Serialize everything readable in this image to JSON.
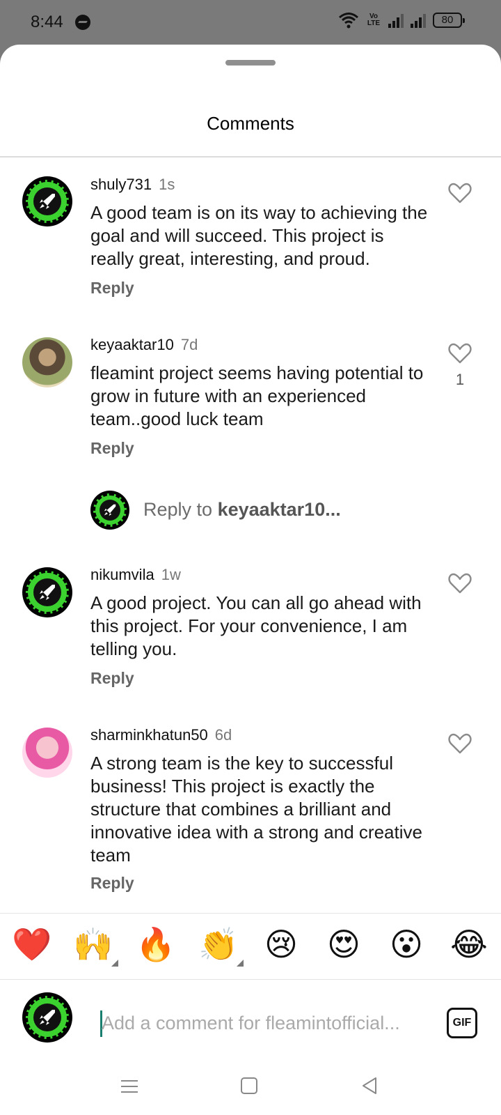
{
  "status_bar": {
    "time": "8:44",
    "volte_label": "Vo LTE",
    "battery": "80"
  },
  "sheet": {
    "title": "Comments"
  },
  "comments": [
    {
      "username": "shuly731",
      "timestamp": "1s",
      "text": "A good team is on its way to achieving the goal and will succeed. This project is really great, interesting, and proud.",
      "reply_label": "Reply",
      "likes": ""
    },
    {
      "username": "keyaaktar10",
      "timestamp": "7d",
      "text": "fleamint project seems having potential to grow in future with an experienced team..good luck team",
      "reply_label": "Reply",
      "likes": "1"
    },
    {
      "username": "nikumvila",
      "timestamp": "1w",
      "text": "A good project. You can all go ahead with this project. For your convenience, I am telling you.",
      "reply_label": "Reply",
      "likes": ""
    },
    {
      "username": "sharminkhatun50",
      "timestamp": "6d",
      "text": "A strong team is the key to successful business! This project is exactly the structure that combines a brilliant and innovative idea with a strong and creative team",
      "reply_label": "Reply",
      "likes": ""
    }
  ],
  "reply_prompt": {
    "prefix": "Reply to ",
    "target": "keyaaktar10..."
  },
  "emoji_bar": [
    "❤️",
    "🙌",
    "🔥",
    "👏",
    "😢",
    "😍",
    "😮",
    "😂"
  ],
  "input": {
    "placeholder": "Add a comment for fleamintofficial...",
    "gif_label": "GIF"
  },
  "icons": {
    "like": "heart-outline-icon",
    "brand_green": "#3bd12f"
  }
}
